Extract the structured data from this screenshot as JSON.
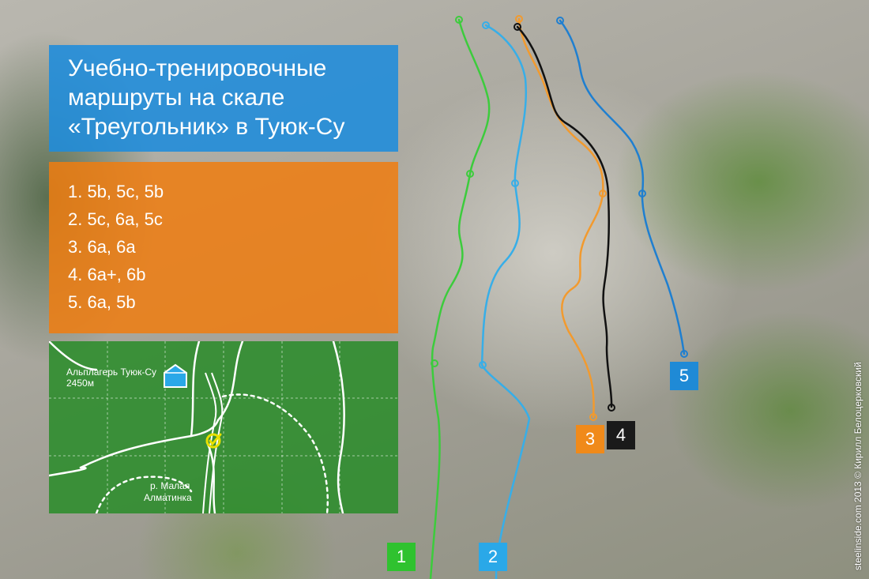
{
  "title_lines": [
    "Учебно-тренировочные",
    "маршруты на скале",
    "«Треугольник» в Туюк-Су"
  ],
  "grades": [
    "1. 5b, 5c, 5b",
    "2. 5c, 6a, 5c",
    "3. 6a, 6a",
    "4. 6a+, 6b",
    "5. 6a, 5b"
  ],
  "map": {
    "camp_label_line1": "Альплагерь Туюк-Су",
    "camp_label_line2": "2450м",
    "river_label_line1": "р. Малая",
    "river_label_line2": "Алматинка",
    "icons": [
      "house-icon",
      "location-target-icon"
    ]
  },
  "route_labels": [
    {
      "number": "1",
      "color": "#2fc22f"
    },
    {
      "number": "2",
      "color": "#2aa8e8"
    },
    {
      "number": "3",
      "color": "#f08a1a"
    },
    {
      "number": "4",
      "color": "#1a1a1a"
    },
    {
      "number": "5",
      "color": "#1f8ad6"
    }
  ],
  "route_colors": {
    "green": "#3ccc3c",
    "light_blue": "#37aee8",
    "orange": "#f29a2e",
    "black": "#111111",
    "blue": "#1f7fd0"
  },
  "credit": "steelinside.com 2013 © Кирилл Белоцерковский"
}
